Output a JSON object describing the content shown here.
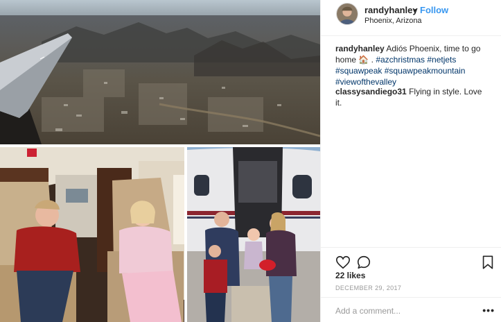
{
  "post": {
    "username": "randyhanley",
    "separator": "•",
    "follow_label": "Follow",
    "location": "Phoenix, Arizona",
    "caption_user": "randyhanley",
    "caption_text": "Adiós Phoenix, time to go home 🏠 .",
    "hashtags": [
      "#azchristmas",
      "#netjets",
      "#squawpeak",
      "#squawpeakmountain",
      "#viewofthevalley"
    ],
    "comment": {
      "user": "classysandiego31",
      "text": "Flying in style. Love it."
    },
    "likes": "22 likes",
    "date": "DECEMBER 29, 2017",
    "add_comment_placeholder": "Add a comment...",
    "more_label": "•••"
  },
  "icons": {
    "like": "heart-icon",
    "comment": "comment-bubble-icon",
    "save": "bookmark-icon"
  },
  "colors": {
    "link": "#3897f0",
    "hashtag": "#003569",
    "text": "#262626",
    "muted": "#999999",
    "border": "#efefef"
  }
}
